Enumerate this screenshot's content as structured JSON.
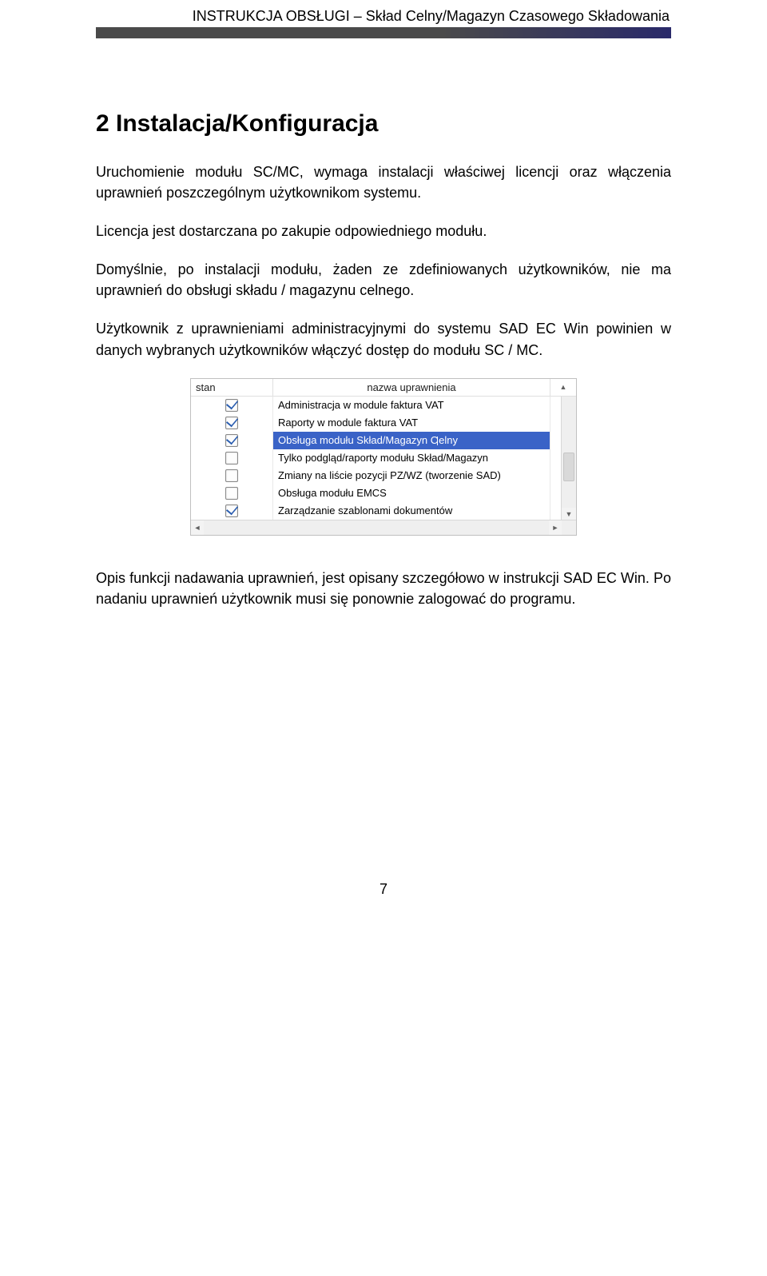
{
  "header": {
    "title": "INSTRUKCJA OBSŁUGI – Skład Celny/Magazyn Czasowego Składowania"
  },
  "heading": "2  Instalacja/Konfiguracja",
  "paragraphs": {
    "p1": "Uruchomienie modułu SC/MC, wymaga instalacji właściwej licencji oraz włączenia uprawnień poszczególnym użytkownikom systemu.",
    "p2": "Licencja jest dostarczana po zakupie odpowiedniego modułu.",
    "p3": "Domyślnie, po instalacji modułu, żaden ze zdefiniowanych użytkowników, nie ma uprawnień do obsługi składu / magazynu celnego.",
    "p4": "Użytkownik z uprawnieniami administracyjnymi do systemu SAD EC Win powinien w danych wybranych użytkowników włączyć dostęp do modułu SC / MC.",
    "p5": "Opis funkcji nadawania uprawnień, jest opisany szczegółowo w instrukcji SAD EC Win. Po nadaniu uprawnień użytkownik musi się ponownie zalogować do programu."
  },
  "table": {
    "headers": {
      "stan": "stan",
      "nazwa": "nazwa uprawnienia"
    },
    "rows": [
      {
        "checked": true,
        "label": "Administracja w module faktura VAT",
        "selected": false
      },
      {
        "checked": true,
        "label": "Raporty w module faktura VAT",
        "selected": false
      },
      {
        "checked": true,
        "label_pre": "Obsługa modułu Skład/Magazyn C",
        "label_post": "elny",
        "selected": true
      },
      {
        "checked": false,
        "label": "Tylko podgląd/raporty modułu Skład/Magazyn",
        "selected": false
      },
      {
        "checked": false,
        "label": "Zmiany na liście pozycji PZ/WZ (tworzenie SAD)",
        "selected": false
      },
      {
        "checked": false,
        "label": "Obsługa modułu EMCS",
        "selected": false
      },
      {
        "checked": true,
        "label": "Zarządzanie szablonami dokumentów",
        "selected": false
      }
    ]
  },
  "page_number": "7"
}
